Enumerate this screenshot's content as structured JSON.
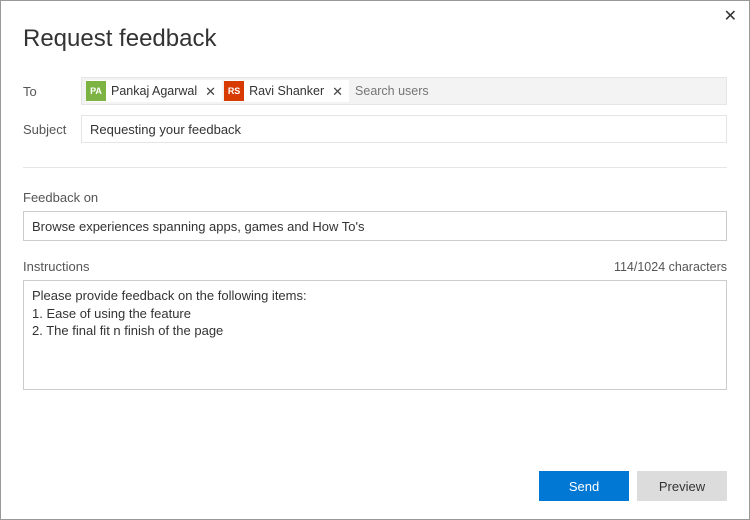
{
  "dialog": {
    "title": "Request feedback"
  },
  "to": {
    "label": "To",
    "placeholder": "Search users",
    "recipients": [
      {
        "initials": "PA",
        "name": "Pankaj Agarwal",
        "color": "green"
      },
      {
        "initials": "RS",
        "name": "Ravi Shanker",
        "color": "red"
      }
    ]
  },
  "subject": {
    "label": "Subject",
    "value": "Requesting your feedback"
  },
  "feedback_on": {
    "label": "Feedback on",
    "value": "Browse experiences spanning apps, games and How To's"
  },
  "instructions": {
    "label": "Instructions",
    "counter": "114/1024 characters",
    "value": "Please provide feedback on the following items:\n1. Ease of using the feature\n2. The final fit n finish of the page"
  },
  "footer": {
    "send": "Send",
    "preview": "Preview"
  }
}
